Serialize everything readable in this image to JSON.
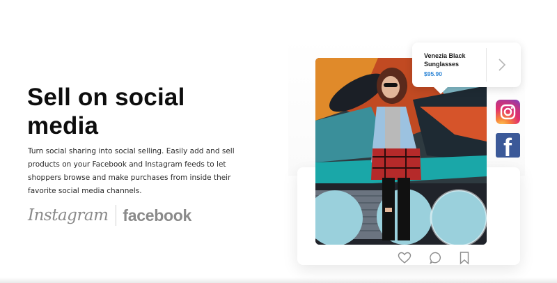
{
  "hero": {
    "title": "Sell on social media",
    "description": "Turn social sharing into social selling. Easily add and sell products on your Facebook and Instagram feeds to let shoppers browse and make purchases from inside their favorite social media channels."
  },
  "brands": {
    "instagram": "Instagram",
    "facebook": "facebook"
  },
  "product_tag": {
    "name": "Venezia Black Sunglasses",
    "price": "$95.90",
    "price_color": "#2f86d6"
  },
  "social_badges": [
    {
      "icon": "instagram-icon"
    },
    {
      "icon": "facebook-icon",
      "color": "#3b5998",
      "glyph": "f"
    }
  ],
  "post_actions": [
    {
      "icon": "heart-icon"
    },
    {
      "icon": "comment-icon"
    },
    {
      "icon": "bookmark-icon"
    }
  ]
}
